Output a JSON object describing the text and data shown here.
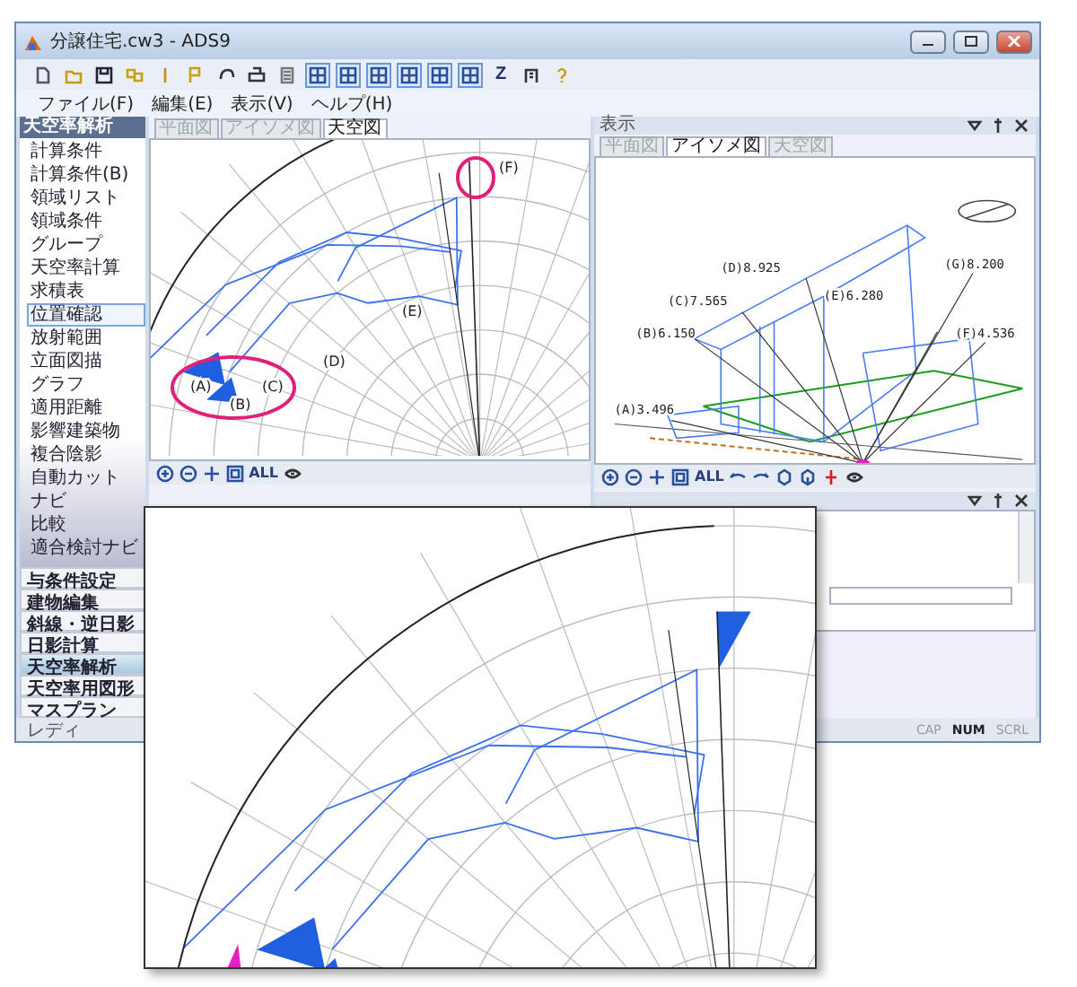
{
  "window": {
    "title": "分譲住宅.cw3 - ADS9"
  },
  "toolbar": {
    "letter_button": "Z"
  },
  "menu": [
    "ファイル(F)",
    "編集(E)",
    "表示(V)",
    "ヘルプ(H)"
  ],
  "sidebar": {
    "header": "天空率解析",
    "items": [
      {
        "label": "計算条件",
        "selected": false
      },
      {
        "label": "計算条件(B)",
        "selected": false
      },
      {
        "label": "領域リスト",
        "selected": false
      },
      {
        "label": "領域条件",
        "selected": false
      },
      {
        "label": "グループ",
        "selected": false
      },
      {
        "label": "天空率計算",
        "selected": false
      },
      {
        "label": "求積表",
        "selected": false
      },
      {
        "label": "位置確認",
        "selected": true
      },
      {
        "label": "放射範囲",
        "selected": false
      },
      {
        "label": "立面図描",
        "selected": false
      },
      {
        "label": "グラフ",
        "selected": false
      },
      {
        "label": "適用距離",
        "selected": false
      },
      {
        "label": "影響建築物",
        "selected": false
      },
      {
        "label": "複合陰影",
        "selected": false
      },
      {
        "label": "自動カット",
        "selected": false
      },
      {
        "label": "ナビ",
        "selected": false
      },
      {
        "label": "比較",
        "selected": false
      },
      {
        "label": "適合検討ナビ",
        "selected": false
      }
    ],
    "sections": [
      {
        "label": "与条件設定",
        "selected": false
      },
      {
        "label": "建物編集",
        "selected": false
      },
      {
        "label": "斜線・逆日影",
        "selected": false
      },
      {
        "label": "日影計算",
        "selected": false
      },
      {
        "label": "天空率解析",
        "selected": true
      },
      {
        "label": "天空率用図形",
        "selected": false
      },
      {
        "label": "マスプラン",
        "selected": false
      }
    ]
  },
  "left_pane": {
    "tabs": [
      {
        "label": "平面図",
        "selected": false
      },
      {
        "label": "アイソメ図",
        "selected": false
      },
      {
        "label": "天空図",
        "selected": true
      }
    ],
    "labels": [
      "(F)",
      "(E)",
      "(D)",
      "(A)",
      "(B)",
      "(C)"
    ],
    "toolbar_label": "ALL"
  },
  "right_pane": {
    "title": "表示",
    "tabs": [
      {
        "label": "平面図",
        "selected": false
      },
      {
        "label": "アイソメ図",
        "selected": true
      },
      {
        "label": "天空図",
        "selected": false
      }
    ],
    "points": [
      "(A)3.496",
      "(B)6.150",
      "(C)7.565",
      "(D)8.925",
      "(E)6.280",
      "(F)4.536",
      "(G)8.200"
    ],
    "toolbar_label": "ALL"
  },
  "status_bar": {
    "text": "レディ",
    "indicators": [
      {
        "label": "CAP",
        "on": false
      },
      {
        "label": "NUM",
        "on": true
      },
      {
        "label": "SCRL",
        "on": false
      }
    ]
  }
}
